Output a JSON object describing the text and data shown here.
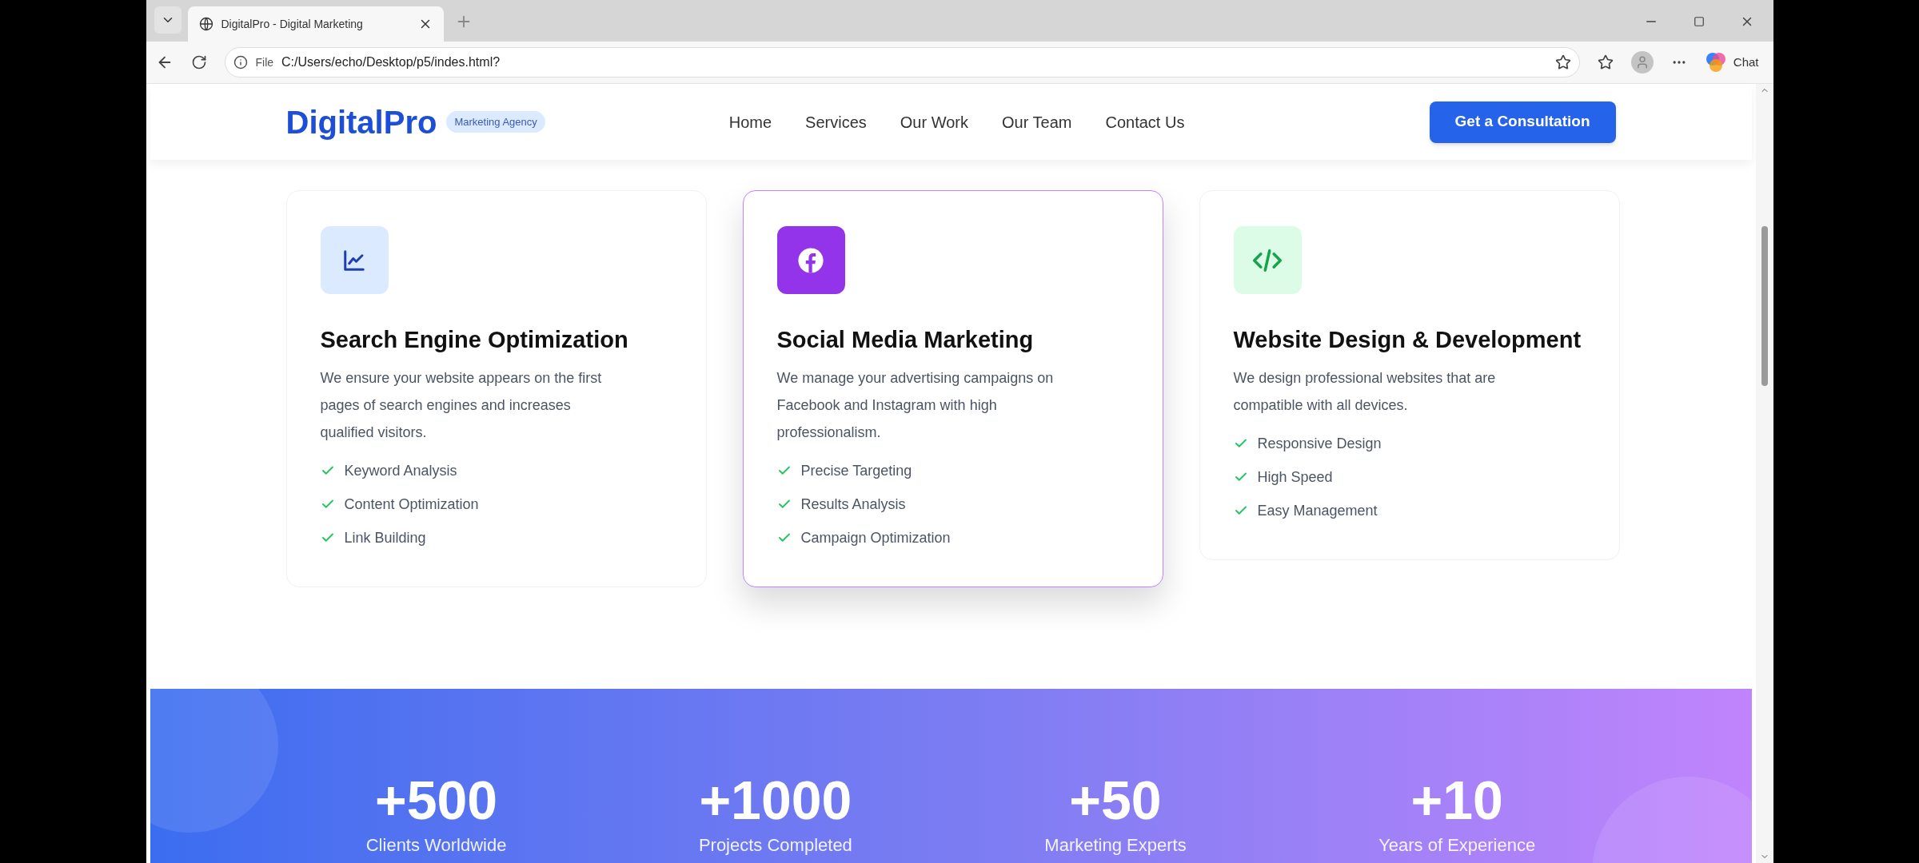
{
  "browser": {
    "tabs": [
      {
        "title": "DigitalPro - Digital Marketing",
        "selected": true
      }
    ],
    "address": {
      "scheme": "File",
      "url": "C:/Users/echo/Desktop/p5/indes.html?"
    },
    "chat_label": "Chat"
  },
  "header": {
    "logo": "DigitalPro",
    "badge": "Marketing Agency",
    "nav": [
      {
        "label": "Home"
      },
      {
        "label": "Services"
      },
      {
        "label": "Our Work"
      },
      {
        "label": "Our Team"
      },
      {
        "label": "Contact Us"
      }
    ],
    "cta": "Get a Consultation"
  },
  "services": [
    {
      "kind": "chart",
      "highlighted": false,
      "title": "Search Engine Optimization",
      "description": "We ensure your website appears on the first pages of search engines and increases qualified visitors.",
      "features": [
        "Keyword Analysis",
        "Content Optimization",
        "Link Building"
      ]
    },
    {
      "kind": "facebook",
      "highlighted": true,
      "title": "Social Media Marketing",
      "description": "We manage your advertising campaigns on Facebook and Instagram with high professionalism.",
      "features": [
        "Precise Targeting",
        "Results Analysis",
        "Campaign Optimization"
      ]
    },
    {
      "kind": "code",
      "highlighted": false,
      "title": "Website Design & Development",
      "description": "We design professional websites that are compatible with all devices.",
      "features": [
        "Responsive Design",
        "High Speed",
        "Easy Management"
      ]
    }
  ],
  "stats": [
    {
      "value": "+500",
      "label": "Clients Worldwide"
    },
    {
      "value": "+1000",
      "label": "Projects Completed"
    },
    {
      "value": "+50",
      "label": "Marketing Experts"
    },
    {
      "value": "+10",
      "label": "Years of Experience"
    }
  ]
}
